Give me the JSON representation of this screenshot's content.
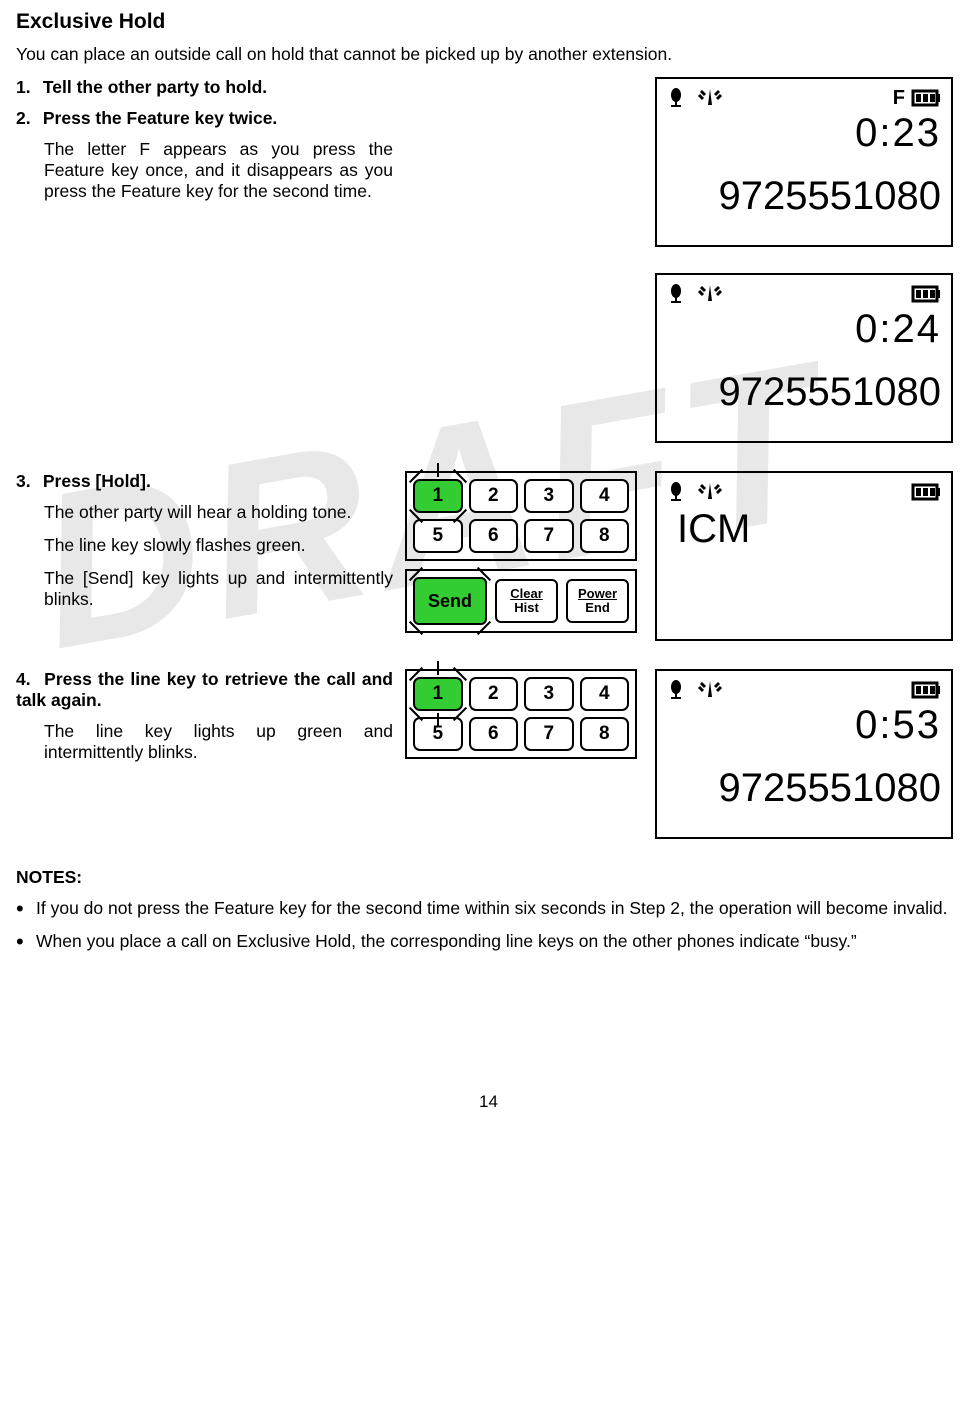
{
  "title": "Exclusive Hold",
  "intro": "You can place an outside call on hold that cannot be picked up by another extension.",
  "steps": {
    "s1": {
      "num": "1.",
      "head": "Tell the other party to hold."
    },
    "s2": {
      "num": "2.",
      "head": "Press the Feature key twice.",
      "body": "The letter F appears as you press the Feature key once, and it disappears as you press the Feature key for the second time."
    },
    "s3": {
      "num": "3.",
      "head": "Press [Hold].",
      "body1": "The other party  will hear a holding tone.",
      "body2": "The line key slowly flashes green.",
      "body3": "The [Send] key lights up and intermittently blinks."
    },
    "s4": {
      "num": "4.",
      "head": "Press the line key to retrieve the call and talk again.",
      "body": "The line key lights up green and intermittently blinks."
    }
  },
  "lcd": {
    "screen1": {
      "f": "F",
      "time": "0:23",
      "number": "9725551080"
    },
    "screen2": {
      "time": "0:24",
      "number": "9725551080"
    },
    "screen3": {
      "label": "ICM"
    },
    "screen4": {
      "time": "0:53",
      "number": "9725551080"
    }
  },
  "keypad": {
    "k1": "1",
    "k2": "2",
    "k3": "3",
    "k4": "4",
    "k5": "5",
    "k6": "6",
    "k7": "7",
    "k8": "8"
  },
  "fn": {
    "send": "Send",
    "clear_top": "Clear",
    "clear_bot": "Hist",
    "power_top": "Power",
    "power_bot": "End"
  },
  "notes": {
    "head": "NOTES:",
    "n1": "If you do not press the Feature key for the second time within six seconds in Step 2, the operation will become invalid.",
    "n2": "When you place a call on Exclusive Hold, the corresponding line keys on the other phones indicate “busy.”"
  },
  "page": "14"
}
